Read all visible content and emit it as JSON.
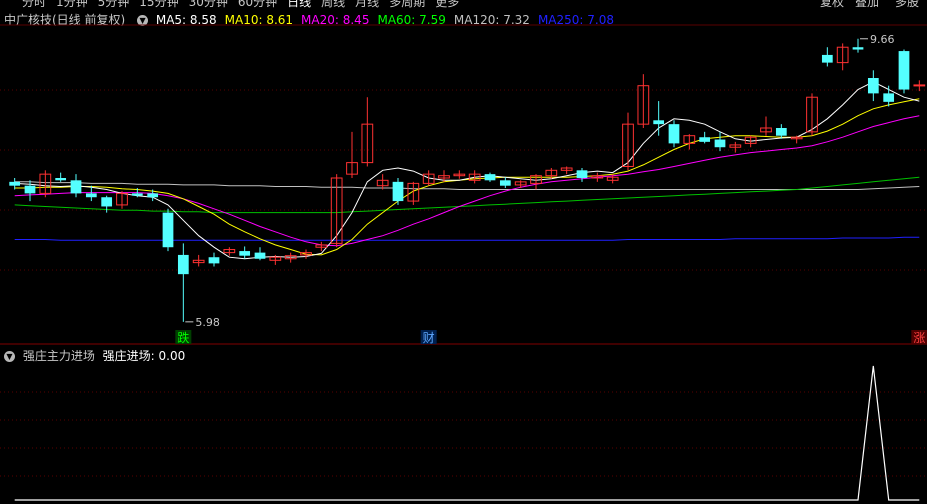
{
  "toolbar": {
    "periods": [
      "分时",
      "1分钟",
      "5分钟",
      "15分钟",
      "30分钟",
      "60分钟",
      "日线",
      "周线",
      "月线",
      "多周期",
      "更多"
    ],
    "active_period": "日线",
    "right_buttons": [
      "复权",
      "叠加",
      "多股"
    ]
  },
  "main_legend": {
    "title": "中广核技(日线 前复权)",
    "ma": [
      {
        "label": "MA5: 8.58",
        "color": "#ffffff"
      },
      {
        "label": "MA10: 8.61",
        "color": "#ffff00"
      },
      {
        "label": "MA20: 8.45",
        "color": "#ff00ff"
      },
      {
        "label": "MA60: 7.59",
        "color": "#00ff00"
      },
      {
        "label": "MA120: 7.32",
        "color": "#c0c0c0"
      },
      {
        "label": "MA250: 7.08",
        "color": "#2020ff"
      }
    ]
  },
  "annotations": {
    "high_label": "9.66",
    "low_label": "5.98",
    "markers": [
      {
        "text": "跌",
        "color": "#00ff00",
        "bg": "#004000"
      },
      {
        "text": "财",
        "color": "#5fa8ff",
        "bg": "#002050"
      },
      {
        "text": "涨",
        "color": "#ff4040",
        "bg": "#500000"
      }
    ]
  },
  "indicator": {
    "name": "强庄主力进场",
    "series_label": "强庄进场: 0.00"
  },
  "chart_data": {
    "type": "candlestick",
    "ohlc": [
      [
        7.8,
        7.85,
        7.7,
        7.75
      ],
      [
        7.75,
        7.82,
        7.55,
        7.65
      ],
      [
        7.65,
        7.95,
        7.6,
        7.9
      ],
      [
        7.85,
        7.92,
        7.8,
        7.82
      ],
      [
        7.82,
        7.9,
        7.6,
        7.65
      ],
      [
        7.65,
        7.75,
        7.55,
        7.6
      ],
      [
        7.6,
        7.62,
        7.4,
        7.48
      ],
      [
        7.5,
        7.68,
        7.45,
        7.65
      ],
      [
        7.65,
        7.72,
        7.6,
        7.62
      ],
      [
        7.65,
        7.7,
        7.55,
        7.6
      ],
      [
        7.4,
        7.45,
        6.9,
        6.95
      ],
      [
        6.85,
        7.0,
        5.98,
        6.6
      ],
      [
        6.75,
        6.85,
        6.7,
        6.78
      ],
      [
        6.82,
        6.88,
        6.7,
        6.74
      ],
      [
        6.88,
        6.95,
        6.84,
        6.92
      ],
      [
        6.9,
        6.96,
        6.8,
        6.84
      ],
      [
        6.88,
        6.95,
        6.78,
        6.8
      ],
      [
        6.78,
        6.85,
        6.72,
        6.82
      ],
      [
        6.8,
        6.88,
        6.75,
        6.84
      ],
      [
        6.85,
        6.92,
        6.8,
        6.88
      ],
      [
        6.95,
        7.02,
        6.9,
        6.98
      ],
      [
        7.0,
        7.9,
        6.95,
        7.85
      ],
      [
        7.9,
        8.45,
        7.85,
        8.05
      ],
      [
        8.05,
        8.9,
        8.0,
        8.55
      ],
      [
        7.75,
        7.9,
        7.7,
        7.82
      ],
      [
        7.8,
        7.85,
        7.5,
        7.55
      ],
      [
        7.55,
        7.8,
        7.5,
        7.78
      ],
      [
        7.78,
        7.95,
        7.75,
        7.9
      ],
      [
        7.85,
        7.95,
        7.8,
        7.88
      ],
      [
        7.88,
        7.95,
        7.84,
        7.9
      ],
      [
        7.82,
        7.95,
        7.78,
        7.9
      ],
      [
        7.9,
        7.92,
        7.8,
        7.82
      ],
      [
        7.82,
        7.86,
        7.72,
        7.75
      ],
      [
        7.76,
        7.82,
        7.72,
        7.8
      ],
      [
        7.78,
        7.9,
        7.7,
        7.88
      ],
      [
        7.88,
        7.98,
        7.84,
        7.95
      ],
      [
        7.95,
        8.0,
        7.9,
        7.98
      ],
      [
        7.95,
        7.98,
        7.8,
        7.85
      ],
      [
        7.85,
        7.92,
        7.8,
        7.88
      ],
      [
        7.82,
        7.9,
        7.78,
        7.86
      ],
      [
        8.0,
        8.7,
        7.95,
        8.55
      ],
      [
        8.55,
        9.2,
        8.5,
        9.05
      ],
      [
        8.6,
        8.85,
        8.4,
        8.55
      ],
      [
        8.55,
        8.6,
        8.25,
        8.3
      ],
      [
        8.3,
        8.42,
        8.22,
        8.4
      ],
      [
        8.38,
        8.45,
        8.3,
        8.32
      ],
      [
        8.35,
        8.45,
        8.2,
        8.25
      ],
      [
        8.25,
        8.32,
        8.18,
        8.28
      ],
      [
        8.3,
        8.4,
        8.25,
        8.38
      ],
      [
        8.45,
        8.65,
        8.4,
        8.5
      ],
      [
        8.5,
        8.55,
        8.36,
        8.4
      ],
      [
        8.36,
        8.4,
        8.3,
        8.38
      ],
      [
        8.45,
        8.95,
        8.4,
        8.9
      ],
      [
        9.45,
        9.55,
        9.3,
        9.35
      ],
      [
        9.35,
        9.6,
        9.25,
        9.55
      ],
      [
        9.55,
        9.66,
        9.48,
        9.52
      ],
      [
        9.15,
        9.25,
        8.85,
        8.95
      ],
      [
        8.95,
        9.05,
        8.78,
        8.84
      ],
      [
        9.5,
        9.52,
        8.95,
        9.0
      ],
      [
        9.05,
        9.12,
        8.98,
        9.06
      ]
    ],
    "ma5": [
      7.78,
      7.77,
      7.75,
      7.74,
      7.75,
      7.73,
      7.7,
      7.65,
      7.62,
      7.6,
      7.5,
      7.3,
      7.1,
      6.95,
      6.82,
      6.8,
      6.82,
      6.83,
      6.82,
      6.83,
      6.87,
      7.1,
      7.4,
      7.8,
      7.95,
      7.98,
      7.94,
      7.85,
      7.82,
      7.82,
      7.86,
      7.88,
      7.86,
      7.84,
      7.82,
      7.84,
      7.88,
      7.92,
      7.94,
      7.92,
      8.05,
      8.3,
      8.5,
      8.62,
      8.6,
      8.55,
      8.45,
      8.36,
      8.33,
      8.35,
      8.37,
      8.38,
      8.48,
      8.62,
      8.8,
      9.0,
      9.1,
      9.0,
      8.9,
      8.85
    ],
    "ma10": [
      7.72,
      7.72,
      7.73,
      7.73,
      7.74,
      7.74,
      7.73,
      7.71,
      7.7,
      7.68,
      7.65,
      7.58,
      7.48,
      7.38,
      7.25,
      7.15,
      7.06,
      6.98,
      6.92,
      6.86,
      6.85,
      6.92,
      7.05,
      7.25,
      7.4,
      7.55,
      7.68,
      7.75,
      7.8,
      7.82,
      7.84,
      7.85,
      7.86,
      7.86,
      7.86,
      7.86,
      7.86,
      7.87,
      7.88,
      7.9,
      7.94,
      8.02,
      8.12,
      8.22,
      8.3,
      8.36,
      8.38,
      8.4,
      8.4,
      8.39,
      8.38,
      8.38,
      8.4,
      8.46,
      8.55,
      8.66,
      8.75,
      8.8,
      8.84,
      8.88
    ],
    "ma20": [
      7.62,
      7.63,
      7.64,
      7.65,
      7.66,
      7.66,
      7.66,
      7.66,
      7.66,
      7.65,
      7.62,
      7.58,
      7.52,
      7.45,
      7.38,
      7.3,
      7.22,
      7.15,
      7.08,
      7.02,
      6.98,
      6.97,
      7.0,
      7.05,
      7.1,
      7.17,
      7.25,
      7.32,
      7.4,
      7.48,
      7.55,
      7.62,
      7.68,
      7.73,
      7.77,
      7.8,
      7.82,
      7.84,
      7.86,
      7.88,
      7.9,
      7.93,
      7.96,
      8.0,
      8.04,
      8.08,
      8.12,
      8.15,
      8.18,
      8.2,
      8.22,
      8.24,
      8.27,
      8.32,
      8.38,
      8.45,
      8.52,
      8.57,
      8.62,
      8.66
    ],
    "ma60": [
      7.5,
      7.49,
      7.48,
      7.47,
      7.46,
      7.45,
      7.44,
      7.43,
      7.43,
      7.42,
      7.42,
      7.41,
      7.41,
      7.4,
      7.4,
      7.4,
      7.4,
      7.4,
      7.4,
      7.4,
      7.4,
      7.4,
      7.41,
      7.42,
      7.43,
      7.44,
      7.45,
      7.46,
      7.47,
      7.48,
      7.49,
      7.5,
      7.51,
      7.52,
      7.53,
      7.54,
      7.55,
      7.56,
      7.57,
      7.58,
      7.59,
      7.6,
      7.61,
      7.62,
      7.63,
      7.64,
      7.65,
      7.66,
      7.67,
      7.68,
      7.69,
      7.7,
      7.72,
      7.74,
      7.76,
      7.78,
      7.8,
      7.82,
      7.84,
      7.86
    ],
    "ma120": [
      7.8,
      7.8,
      7.79,
      7.79,
      7.79,
      7.78,
      7.78,
      7.78,
      7.77,
      7.77,
      7.77,
      7.76,
      7.76,
      7.76,
      7.75,
      7.75,
      7.75,
      7.74,
      7.74,
      7.74,
      7.73,
      7.73,
      7.73,
      7.72,
      7.72,
      7.72,
      7.71,
      7.71,
      7.71,
      7.7,
      7.7,
      7.7,
      7.7,
      7.7,
      7.7,
      7.7,
      7.7,
      7.7,
      7.7,
      7.7,
      7.7,
      7.7,
      7.7,
      7.7,
      7.7,
      7.7,
      7.7,
      7.7,
      7.7,
      7.7,
      7.7,
      7.7,
      7.7,
      7.7,
      7.7,
      7.7,
      7.71,
      7.72,
      7.73,
      7.74
    ],
    "ma250": [
      7.05,
      7.05,
      7.05,
      7.04,
      7.04,
      7.04,
      7.04,
      7.04,
      7.04,
      7.04,
      7.04,
      7.04,
      7.04,
      7.04,
      7.04,
      7.04,
      7.04,
      7.04,
      7.04,
      7.04,
      7.04,
      7.04,
      7.04,
      7.04,
      7.04,
      7.04,
      7.04,
      7.04,
      7.04,
      7.04,
      7.04,
      7.04,
      7.04,
      7.04,
      7.04,
      7.04,
      7.04,
      7.04,
      7.04,
      7.04,
      7.05,
      7.05,
      7.05,
      7.05,
      7.05,
      7.05,
      7.05,
      7.06,
      7.06,
      7.06,
      7.06,
      7.06,
      7.06,
      7.06,
      7.07,
      7.07,
      7.07,
      7.07,
      7.08,
      7.08
    ],
    "price_range": [
      5.9,
      9.8
    ],
    "high_index": 55,
    "low_index": 11,
    "marker_indices": [
      11,
      27,
      59
    ],
    "indicator_values": [
      0,
      0,
      0,
      0,
      0,
      0,
      0,
      0,
      0,
      0,
      0,
      0,
      0,
      0,
      0,
      0,
      0,
      0,
      0,
      0,
      0,
      0,
      0,
      0,
      0,
      0,
      0,
      0,
      0,
      0,
      0,
      0,
      0,
      0,
      0,
      0,
      0,
      0,
      0,
      0,
      0,
      0,
      0,
      0,
      0,
      0,
      0,
      0,
      0,
      0,
      0,
      0,
      0,
      0,
      0,
      0,
      1,
      0,
      0,
      0
    ],
    "indicator_range": [
      0,
      1
    ]
  }
}
